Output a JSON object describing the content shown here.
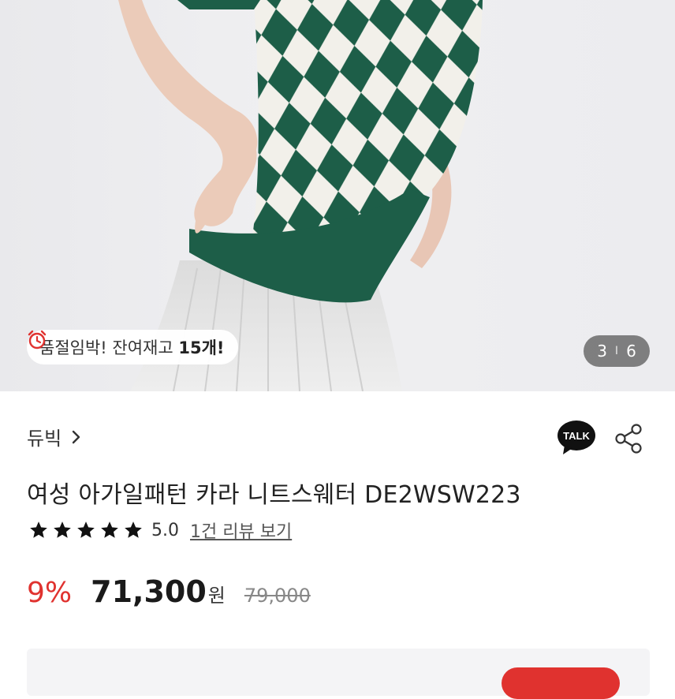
{
  "hero": {
    "stock_badge": {
      "text": "품절임박! 잔여재고 ",
      "count": "15개!",
      "icon": "alarm-clock-icon"
    },
    "image_counter": {
      "current": "3",
      "separator": "I",
      "total": "6"
    }
  },
  "brand": {
    "name": "듀빅",
    "chevron_icon": "chevron-right-icon"
  },
  "actions": {
    "talk_label": "TALK",
    "share_icon": "share-icon"
  },
  "product": {
    "title": "여성 아가일패턴 카라 니트스웨터 DE2WSW223",
    "rating": {
      "stars": 5,
      "score": "5.0",
      "review_link": "1건 리뷰 보기"
    },
    "price": {
      "discount": "9%",
      "sale_price": "71,300",
      "currency": "원",
      "original_price": "79,000"
    }
  },
  "colors": {
    "accent_red": "#e0322f",
    "sweater_green": "#1d5e48",
    "star": "#111111"
  }
}
